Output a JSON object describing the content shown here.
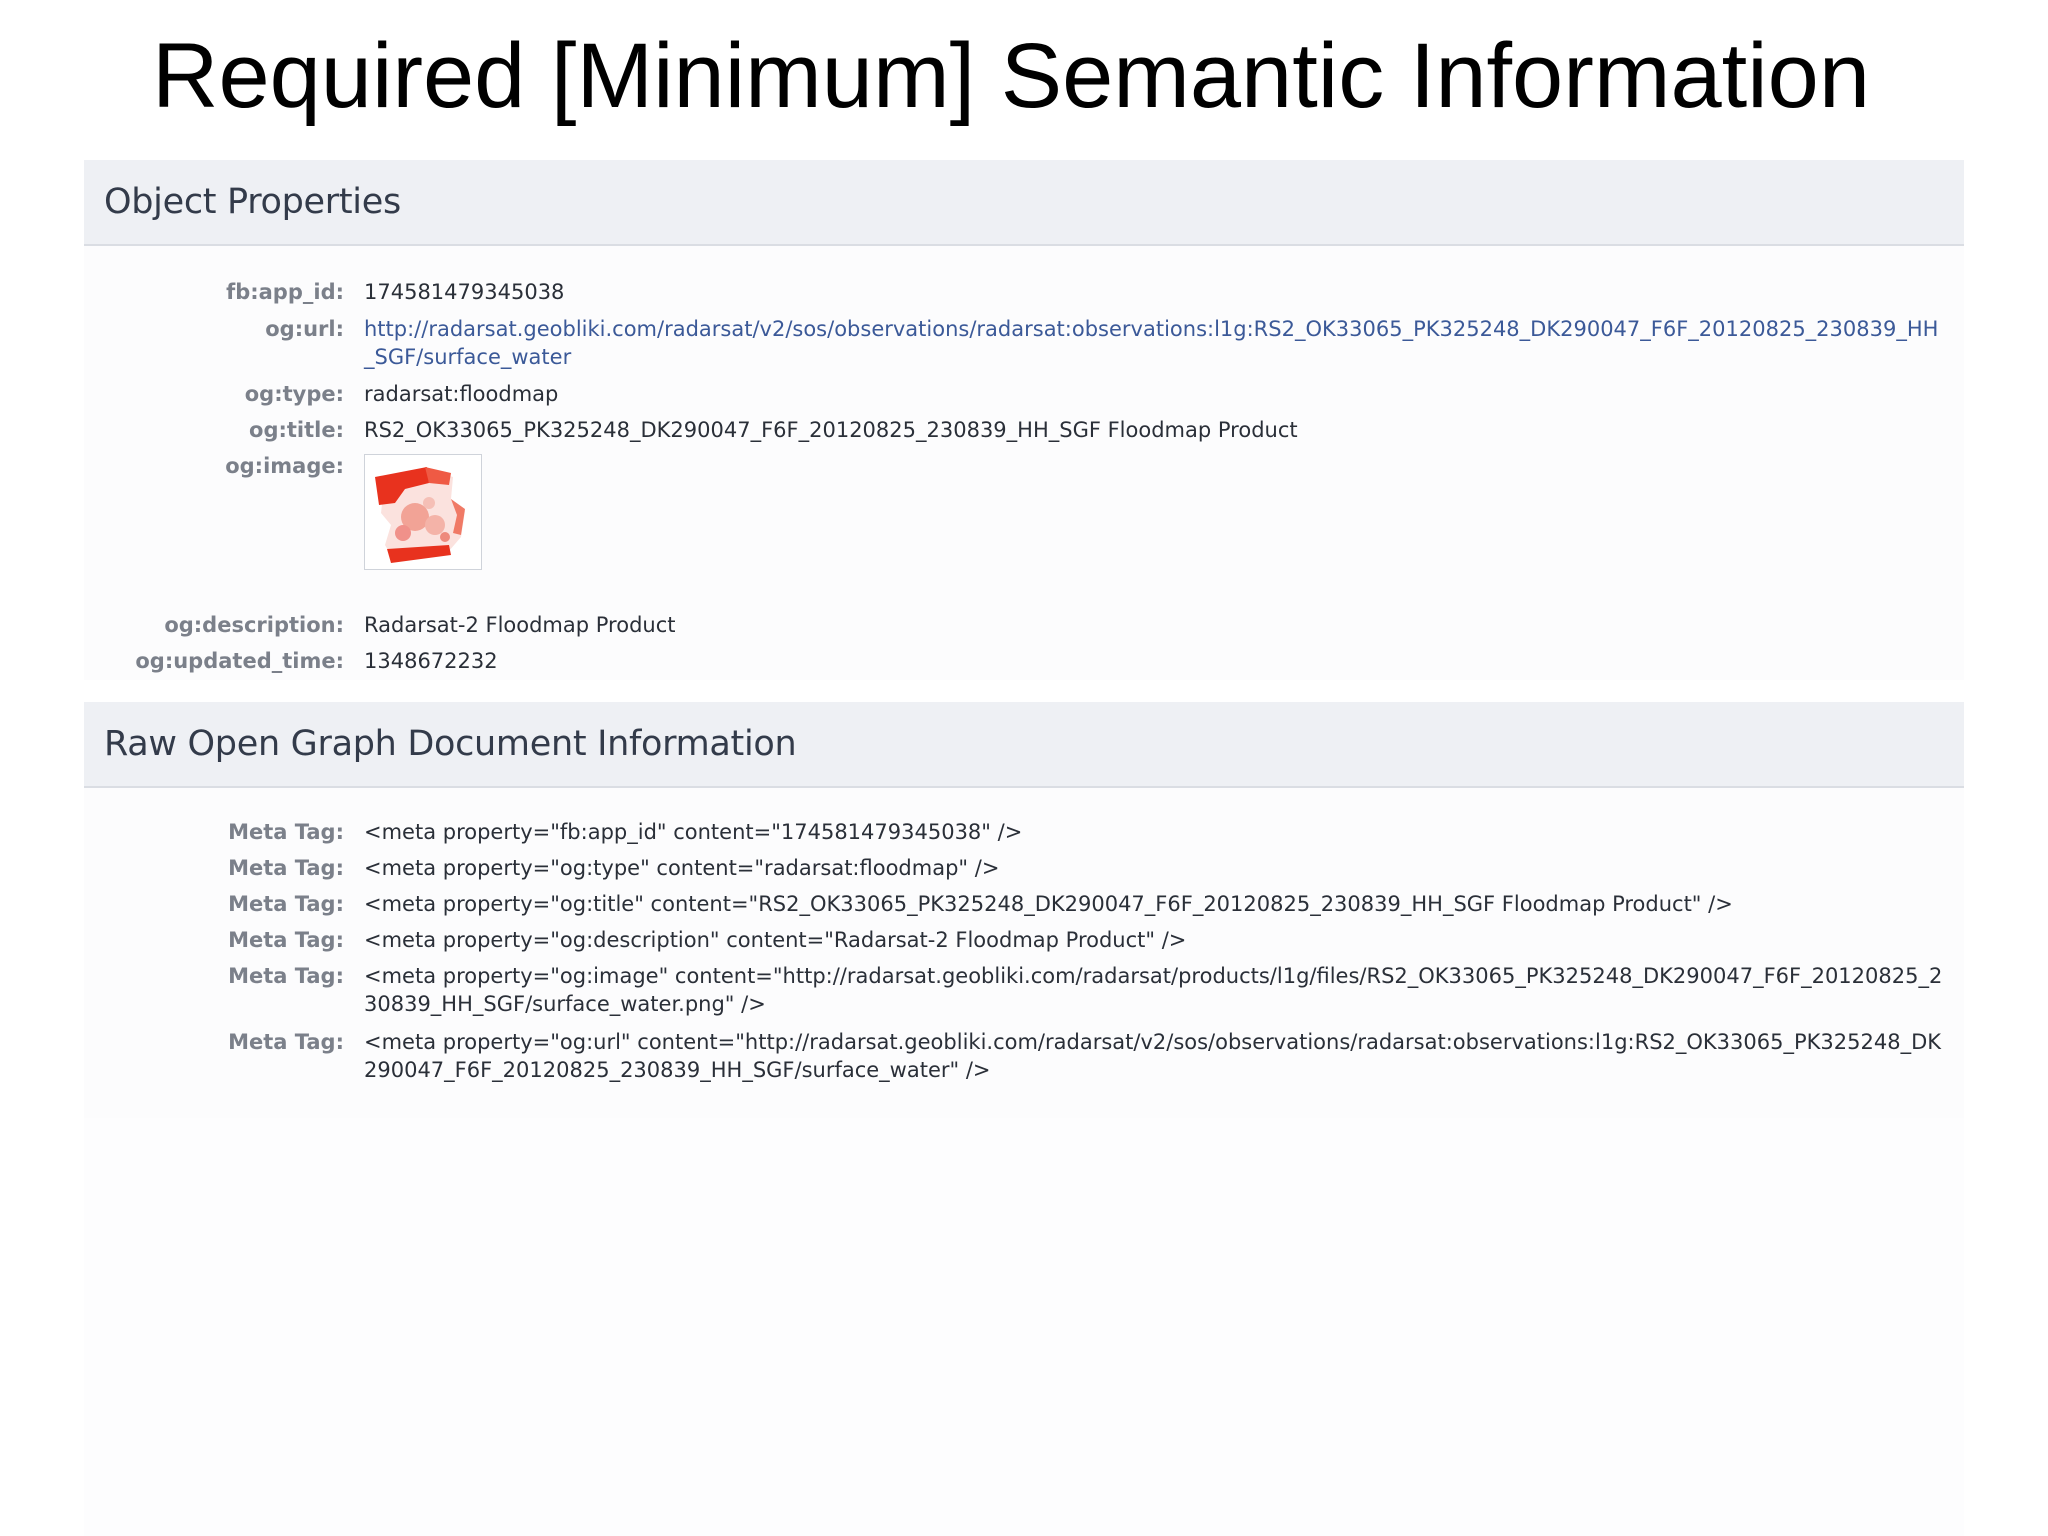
{
  "slide": {
    "title": "Required [Minimum] Semantic Information"
  },
  "object_properties": {
    "header": "Object Properties",
    "rows": [
      {
        "label": "fb:app_id:",
        "value": "174581479345038"
      },
      {
        "label": "og:url:",
        "value": "http://radarsat.geobliki.com/radarsat/v2/sos/observations/radarsat:observations:l1g:RS2_OK33065_PK325248_DK290047_F6F_20120825_230839_HH_SGF/surface_water"
      },
      {
        "label": "og:type:",
        "value": "radarsat:floodmap"
      },
      {
        "label": "og:title:",
        "value": "RS2_OK33065_PK325248_DK290047_F6F_20120825_230839_HH_SGF Floodmap Product"
      },
      {
        "label": "og:image:",
        "value": "floodmap-thumbnail"
      },
      {
        "label": "og:description:",
        "value": "Radarsat-2 Floodmap Product"
      },
      {
        "label": "og:updated_time:",
        "value": "1348672232"
      }
    ]
  },
  "raw_document": {
    "header": "Raw Open Graph Document Information",
    "rows": [
      {
        "label": "Meta Tag:",
        "value": "<meta property=\"fb:app_id\" content=\"174581479345038\" />"
      },
      {
        "label": "Meta Tag:",
        "value": "<meta property=\"og:type\" content=\"radarsat:floodmap\" />"
      },
      {
        "label": "Meta Tag:",
        "value": "<meta property=\"og:title\" content=\"RS2_OK33065_PK325248_DK290047_F6F_20120825_230839_HH_SGF Floodmap Product\" />"
      },
      {
        "label": "Meta Tag:",
        "value": "<meta property=\"og:description\" content=\"Radarsat-2 Floodmap Product\" />"
      },
      {
        "label": "Meta Tag:",
        "value": "<meta property=\"og:image\" content=\"http://radarsat.geobliki.com/radarsat/products/l1g/files/RS2_OK33065_PK325248_DK290047_F6F_20120825_230839_HH_SGF/surface_water.png\" />"
      },
      {
        "label": "Meta Tag:",
        "value": "<meta property=\"og:url\" content=\"http://radarsat.geobliki.com/radarsat/v2/sos/observations/radarsat:observations:l1g:RS2_OK33065_PK325248_DK290047_F6F_20120825_230839_HH_SGF/surface_water\" />"
      }
    ]
  },
  "colors": {
    "link": "#3b5998",
    "header_bg": "#eef0f4",
    "thumbnail_red": "#e8321e"
  }
}
